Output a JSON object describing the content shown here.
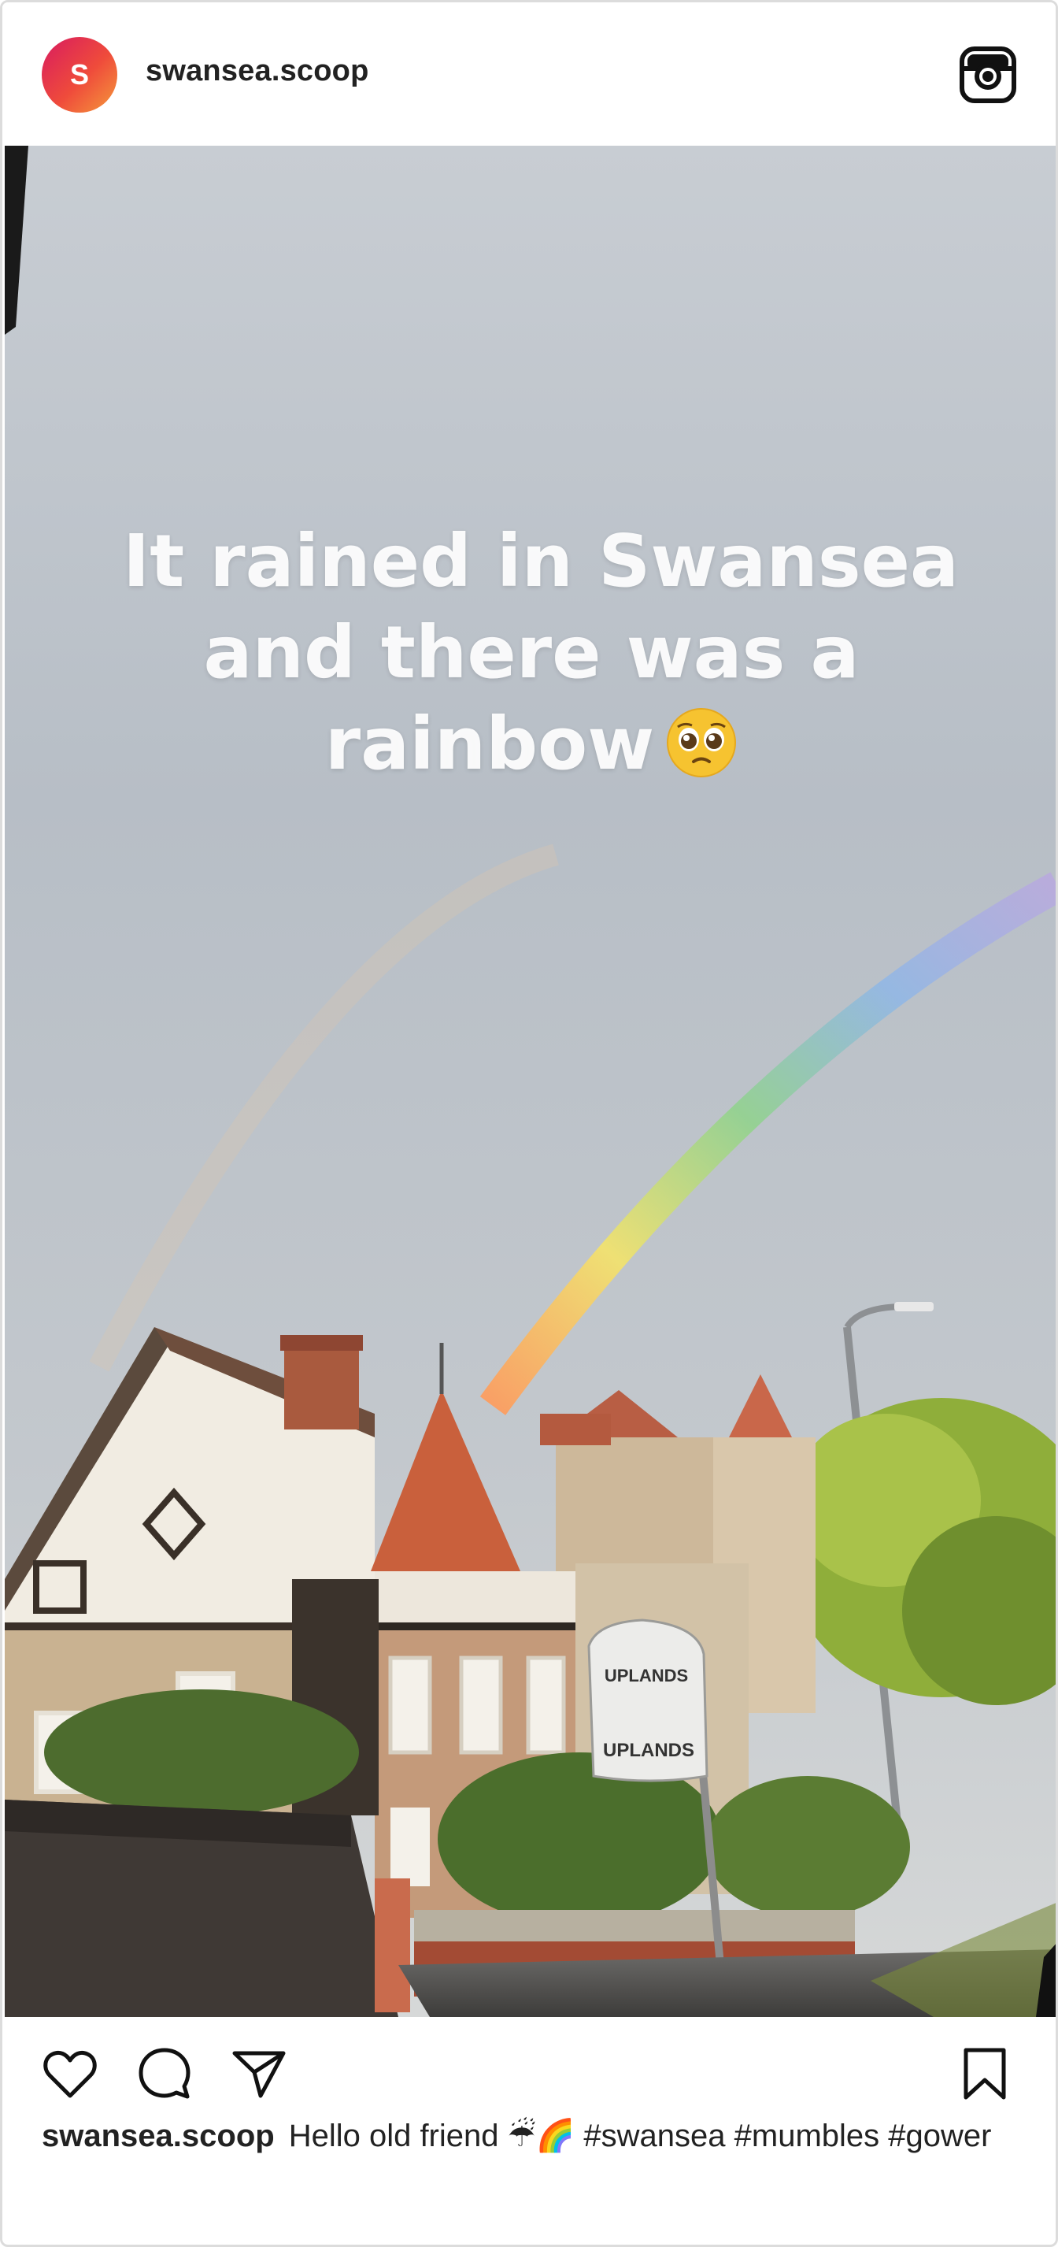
{
  "post": {
    "avatar_letter": "S",
    "username": "swansea.scoop",
    "header_icon": "instagram-icon",
    "media": {
      "overlay_lines": [
        "It rained in Swansea",
        "and there was a",
        "rainbow"
      ],
      "overlay_emoji": "pleading-face-emoji",
      "sign_text": [
        "UPLANDS",
        "UPLANDS"
      ]
    },
    "actions": {
      "like_icon": "heart-icon",
      "comment_icon": "speech-bubble-icon",
      "share_icon": "paper-plane-icon",
      "save_icon": "bookmark-icon"
    },
    "caption": {
      "username": "swansea.scoop",
      "text": "Hello old friend ☔🌈",
      "hashtags": [
        "#swansea",
        "#mumbles",
        "#gower"
      ]
    }
  },
  "colors": {
    "avatar_gradient_start": "#d81b60",
    "avatar_gradient_end": "#f59a3b",
    "text": "#222222",
    "border": "#dcdcdc"
  }
}
